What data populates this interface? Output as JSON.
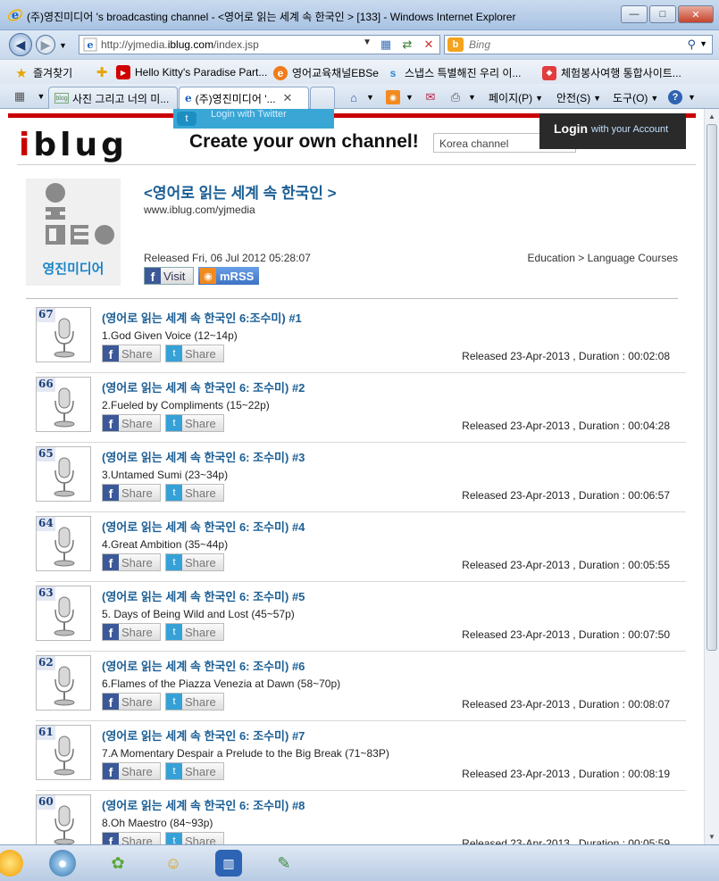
{
  "window": {
    "title": "(주)영진미디어 's broadcasting channel - <영어로 읽는 세계 속 한국인 > [133] - Windows Internet Explorer",
    "controls": {
      "minimize": "—",
      "maximize": "□",
      "close": "✕"
    }
  },
  "nav": {
    "back": "◀",
    "forward": "▶",
    "url_prefix": "http://yjmedia.",
    "url_domain": "iblug.com",
    "url_path": "/index.jsp",
    "search_placeholder": "Bing",
    "search_logo": "b"
  },
  "favorites": {
    "label": "즐겨찾기",
    "items": [
      {
        "label": "Hello Kitty's Paradise Part...",
        "icon": "youtube-icon"
      },
      {
        "label": "영어교육채널EBSe",
        "icon": "e-icon"
      },
      {
        "label": "스냅스 특별해진 우리 이...",
        "icon": "s-icon"
      },
      {
        "label": "체험봉사여행 통합사이트...",
        "icon": "site-icon"
      }
    ]
  },
  "tabs": [
    {
      "label": "사진 그리고 너의 미...",
      "active": false
    },
    {
      "label": "(주)영진미디어 '...",
      "active": true
    }
  ],
  "commands": {
    "page": "페이지(P)",
    "safety": "안전(S)",
    "tools": "도구(O)"
  },
  "site": {
    "twitter_login": "Login with Twitter",
    "logo_text": "iblug",
    "slogan": "Create your own channel!",
    "country_select": "Korea channel",
    "login": "Login",
    "login_sub": "with your Account"
  },
  "channel": {
    "logo_name": "영진미디어",
    "title": "<영어로 읽는 세계 속 한국인 >",
    "url": "www.iblug.com/yjmedia",
    "released": "Released Fri, 06 Jul 2012 05:28:07",
    "category": "Education > Language Courses",
    "visit_label": "Visit",
    "rss_label": "mRSS"
  },
  "share": {
    "facebook": "Share",
    "twitter": "Share"
  },
  "episodes": [
    {
      "num": "67",
      "title": "(영어로 읽는 세계 속 한국인 6:조수미) #1",
      "subtitle": "1.God Given Voice (12~14p)",
      "meta": "Released 23-Apr-2013 , Duration : 00:02:08"
    },
    {
      "num": "66",
      "title": "(영어로 읽는 세계 속 한국인 6: 조수미) #2",
      "subtitle": "2.Fueled by Compliments (15~22p)",
      "meta": "Released 23-Apr-2013 , Duration : 00:04:28"
    },
    {
      "num": "65",
      "title": "(영어로 읽는 세계 속 한국인 6: 조수미) #3",
      "subtitle": "3.Untamed Sumi (23~34p)",
      "meta": "Released 23-Apr-2013 , Duration : 00:06:57"
    },
    {
      "num": "64",
      "title": "(영어로 읽는 세계 속 한국인 6: 조수미) #4",
      "subtitle": "4.Great Ambition (35~44p)",
      "meta": "Released 23-Apr-2013 , Duration : 00:05:55"
    },
    {
      "num": "63",
      "title": "(영어로 읽는 세계 속 한국인 6: 조수미) #5",
      "subtitle": "5. Days of Being Wild and Lost (45~57p)",
      "meta": "Released 23-Apr-2013 , Duration : 00:07:50"
    },
    {
      "num": "62",
      "title": "(영어로 읽는 세계 속 한국인 6: 조수미) #6",
      "subtitle": "6.Flames of the Piazza Venezia at Dawn (58~70p)",
      "meta": "Released 23-Apr-2013 , Duration : 00:08:07"
    },
    {
      "num": "61",
      "title": "(영어로 읽는 세계 속 한국인 6: 조수미) #7",
      "subtitle": "7.A Momentary Despair a Prelude to the Big Break (71~83P)",
      "meta": "Released 23-Apr-2013 , Duration : 00:08:19"
    },
    {
      "num": "60",
      "title": "(영어로 읽는 세계 속 한국인 6: 조수미) #8",
      "subtitle": "8.Oh Maestro (84~93p)",
      "meta": "Released 23-Apr-2013 , Duration : 00:05:59"
    }
  ],
  "colors": {
    "link_blue": "#1b5e94",
    "brand_red": "#c90000",
    "facebook": "#3b5998",
    "twitter": "#36a1d6"
  }
}
